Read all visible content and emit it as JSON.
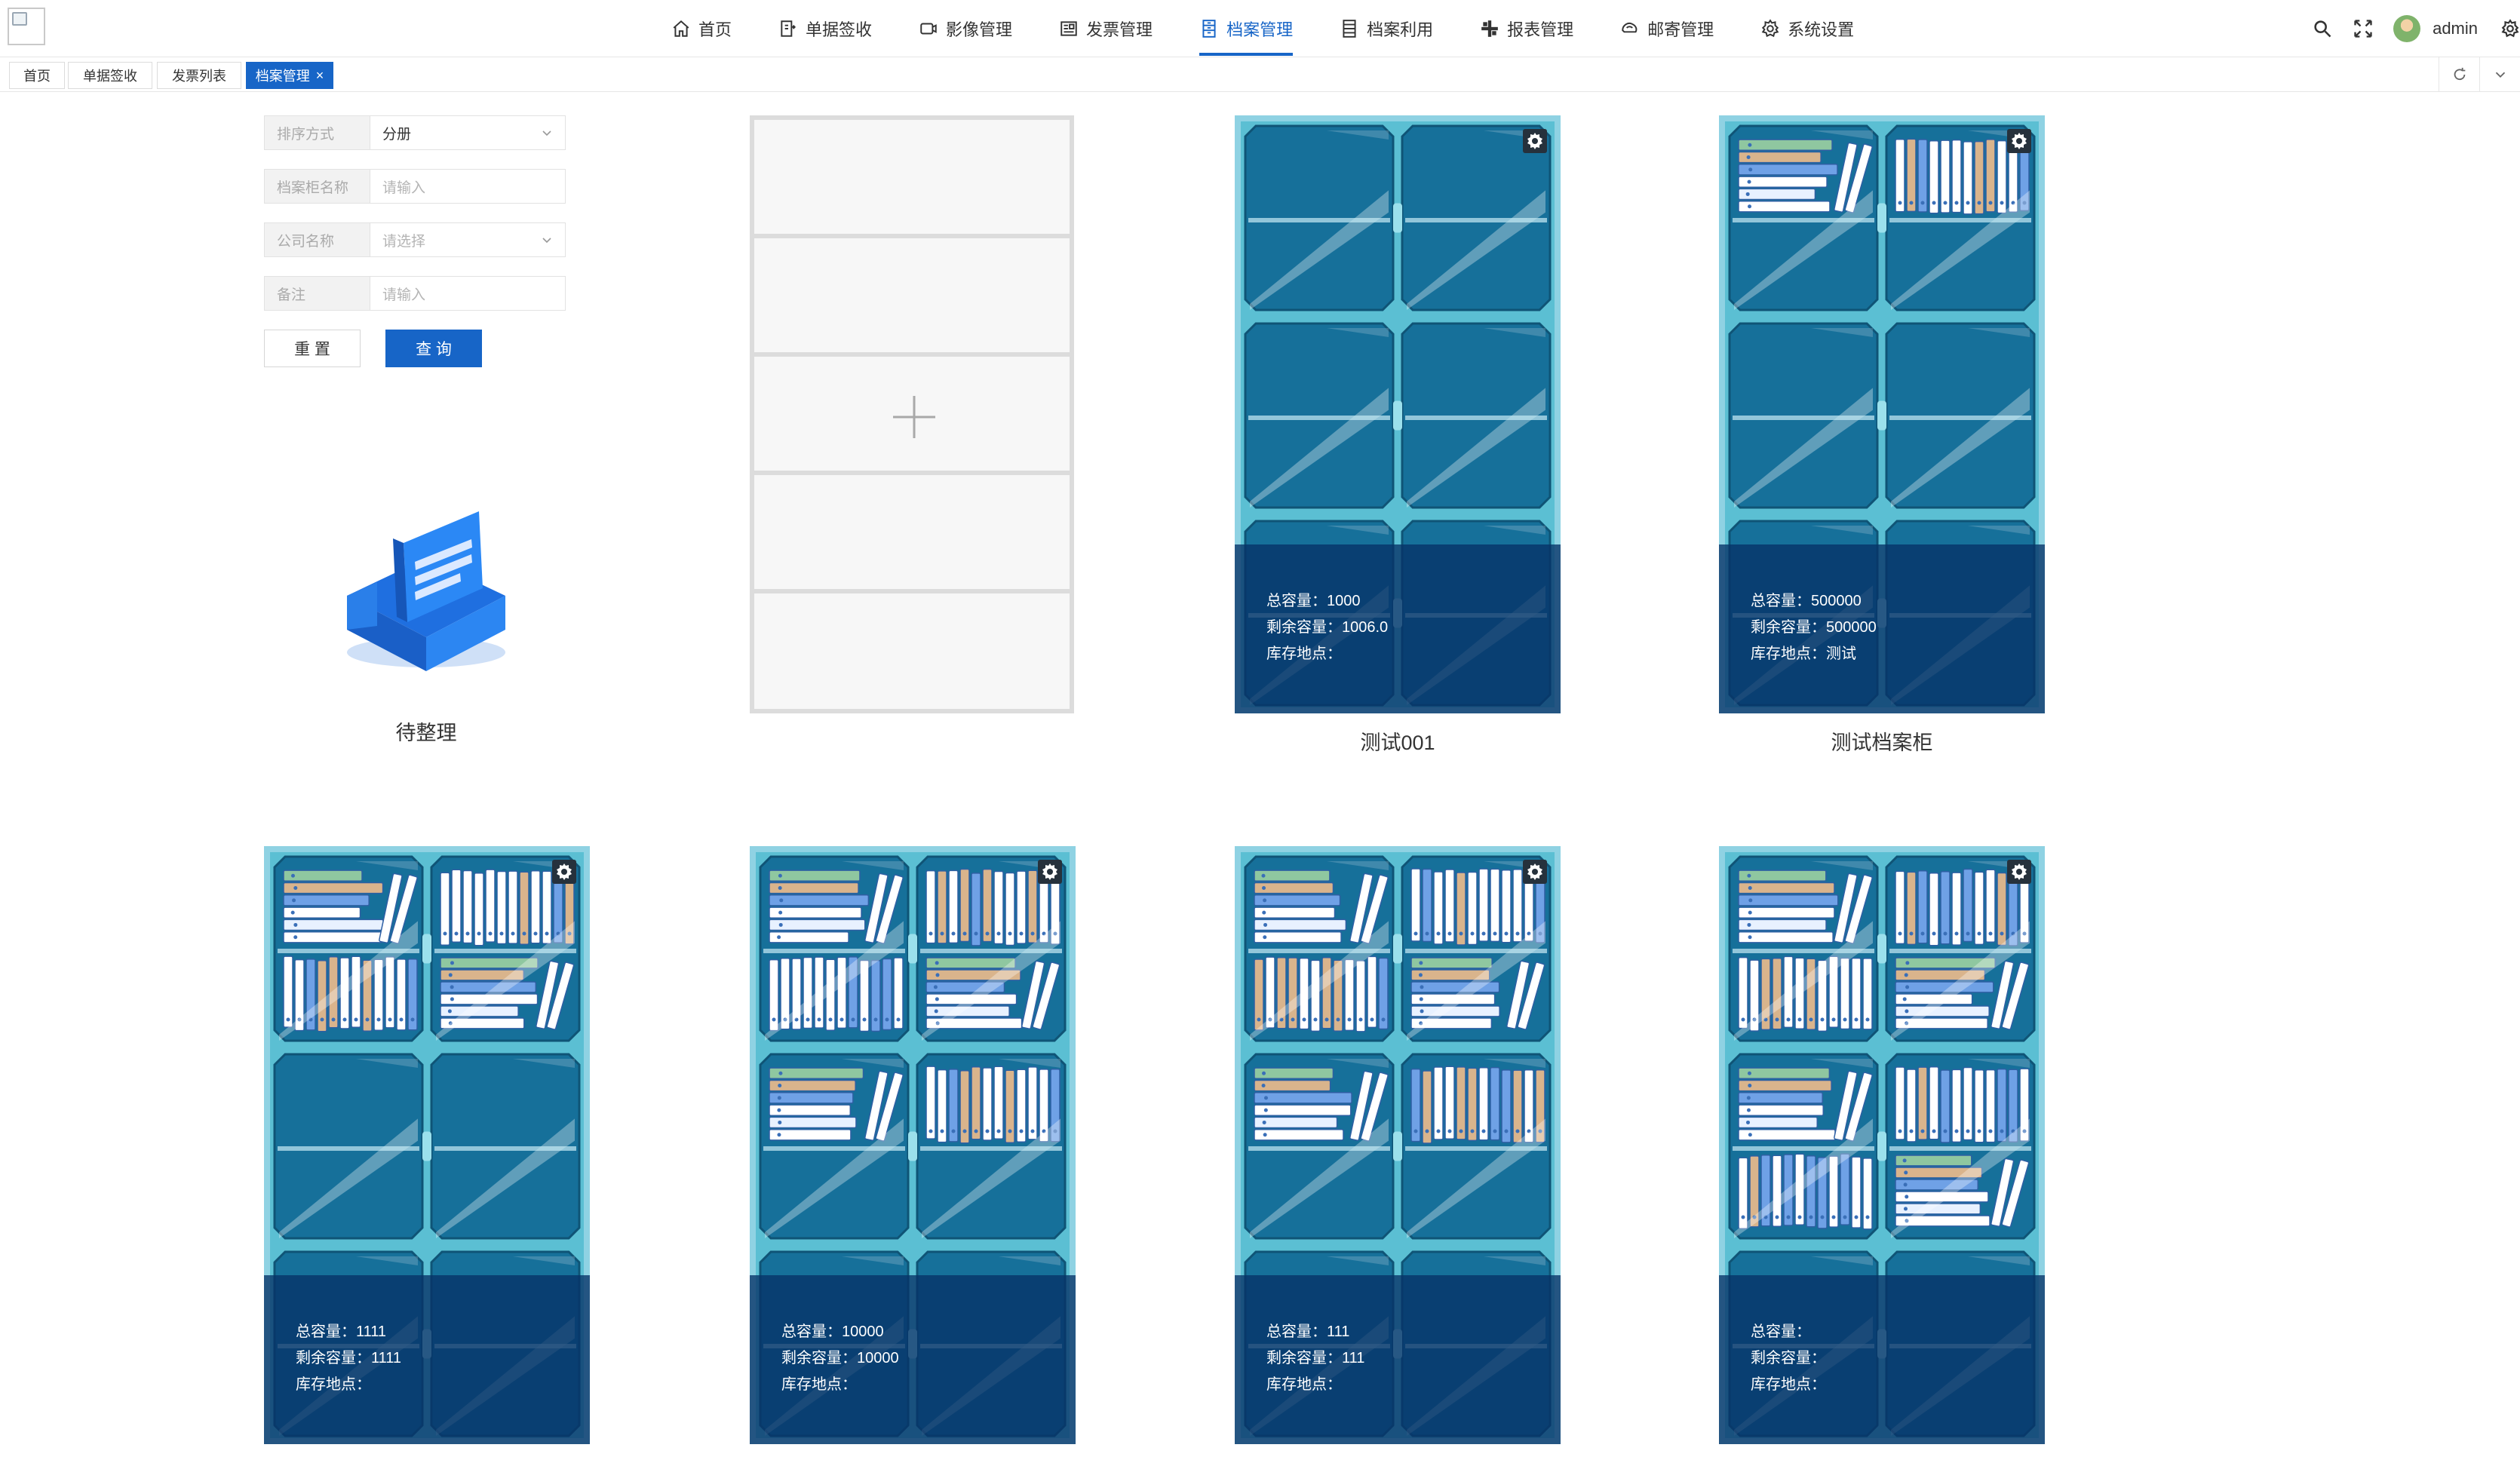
{
  "nav": {
    "items": [
      {
        "label": "首页",
        "icon": "home-icon"
      },
      {
        "label": "单据签收",
        "icon": "document-sign-icon"
      },
      {
        "label": "影像管理",
        "icon": "camera-icon"
      },
      {
        "label": "发票管理",
        "icon": "invoice-icon"
      },
      {
        "label": "档案管理",
        "icon": "archive-icon",
        "active": true
      },
      {
        "label": "档案利用",
        "icon": "archive-use-icon"
      },
      {
        "label": "报表管理",
        "icon": "report-icon"
      },
      {
        "label": "邮寄管理",
        "icon": "mail-icon"
      },
      {
        "label": "系统设置",
        "icon": "settings-icon"
      }
    ],
    "username": "admin",
    "accent": "#1765c7"
  },
  "tabs": [
    {
      "label": "首页"
    },
    {
      "label": "单据签收"
    },
    {
      "label": "发票列表"
    },
    {
      "label": "档案管理",
      "active": true,
      "close": "×"
    }
  ],
  "filters": {
    "sort": {
      "label": "排序方式",
      "value": "分册"
    },
    "cabinet_name": {
      "label": "档案柜名称",
      "placeholder": "请输入"
    },
    "company": {
      "label": "公司名称",
      "placeholder": "请选择"
    },
    "remark": {
      "label": "备注",
      "placeholder": "请输入"
    },
    "reset_label": "重 置",
    "query_label": "查 询"
  },
  "pending": {
    "label": "待整理"
  },
  "info_labels": {
    "total": "总容量：",
    "remaining": "剩余容量：",
    "location": "库存地点："
  },
  "cabinets": [
    {
      "name": "测试001",
      "total": "1000",
      "remaining": "1006.0",
      "location": "",
      "fill": [
        "empty",
        "empty",
        "empty",
        "empty"
      ]
    },
    {
      "name": "测试档案柜",
      "total": "500000",
      "remaining": "500000",
      "location": "测试",
      "fill": [
        "half",
        "half",
        "empty",
        "empty"
      ]
    },
    {
      "name": "",
      "total": "1111",
      "remaining": "1111",
      "location": "",
      "fill": [
        "full",
        "full",
        "empty",
        "empty"
      ]
    },
    {
      "name": "",
      "total": "10000",
      "remaining": "10000",
      "location": "",
      "fill": [
        "full",
        "full",
        "half",
        "half"
      ]
    },
    {
      "name": "",
      "total": "111",
      "remaining": "111",
      "location": "",
      "fill": [
        "full",
        "full",
        "half",
        "half"
      ]
    },
    {
      "name": "",
      "total": "",
      "remaining": "",
      "location": "",
      "fill": [
        "full",
        "full",
        "full",
        "full"
      ]
    }
  ]
}
